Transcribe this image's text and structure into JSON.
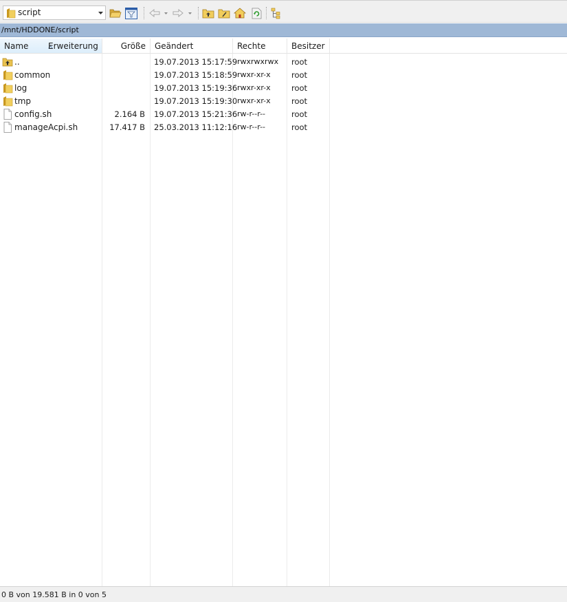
{
  "toolbar": {
    "location": "script",
    "buttons": [
      "open-folder-icon",
      "filter-icon",
      "back-icon",
      "forward-icon",
      "parent-folder-icon",
      "root-folder-icon",
      "home-icon",
      "refresh-icon",
      "tree-view-icon"
    ]
  },
  "path": "/mnt/HDDONE/script",
  "columns": {
    "name": "Name",
    "extension": "Erweiterung",
    "size": "Größe",
    "modified": "Geändert",
    "rights": "Rechte",
    "owner": "Besitzer"
  },
  "rows": [
    {
      "name": "..",
      "type": "parent",
      "size": "",
      "modified": "19.07.2013 15:17:59",
      "rights": "rwxrwxrwx",
      "owner": "root"
    },
    {
      "name": "common",
      "type": "folder",
      "size": "",
      "modified": "19.07.2013 15:18:59",
      "rights": "rwxr-xr-x",
      "owner": "root"
    },
    {
      "name": "log",
      "type": "folder",
      "size": "",
      "modified": "19.07.2013 15:19:36",
      "rights": "rwxr-xr-x",
      "owner": "root"
    },
    {
      "name": "tmp",
      "type": "folder",
      "size": "",
      "modified": "19.07.2013 15:19:30",
      "rights": "rwxr-xr-x",
      "owner": "root"
    },
    {
      "name": "config.sh",
      "type": "file",
      "size": "2.164 B",
      "modified": "19.07.2013 15:21:36",
      "rights": "rw-r--r--",
      "owner": "root"
    },
    {
      "name": "manageAcpi.sh",
      "type": "file",
      "size": "17.417 B",
      "modified": "25.03.2013 11:12:16",
      "rights": "rw-r--r--",
      "owner": "root"
    }
  ],
  "status": "0 B von 19.581 B in 0 von 5",
  "colors": {
    "pathbar": "#9fb8d6",
    "folder": "#e9c24f",
    "header_active": "#dceefb"
  }
}
